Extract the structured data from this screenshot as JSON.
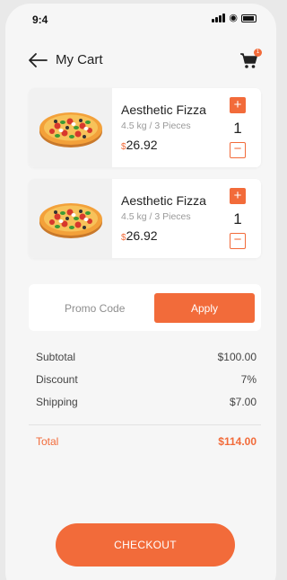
{
  "status_bar": {
    "time": "9:4"
  },
  "header": {
    "title": "My Cart",
    "cart_badge": "1"
  },
  "items": [
    {
      "name": "Aesthetic Fizza",
      "weight": "4.5 kg / 3 Pieces",
      "currency": "$",
      "price": "26.92",
      "quantity": "1",
      "plus": "+",
      "minus": "−"
    },
    {
      "name": "Aesthetic Fizza",
      "weight": "4.5 kg / 3 Pieces",
      "currency": "$",
      "price": "26.92",
      "quantity": "1",
      "plus": "+",
      "minus": "−"
    }
  ],
  "promo": {
    "placeholder": "Promo Code",
    "apply_label": "Apply"
  },
  "summary": {
    "subtotal_label": "Subtotal",
    "subtotal_value": "$100.00",
    "discount_label": "Discount",
    "discount_value": "7%",
    "shipping_label": "Shipping",
    "shipping_value": "$7.00",
    "total_label": "Total",
    "total_value": "$114.00"
  },
  "checkout_label": "CHECKOUT",
  "colors": {
    "accent": "#f26b3a",
    "background": "#f6f6f6"
  }
}
